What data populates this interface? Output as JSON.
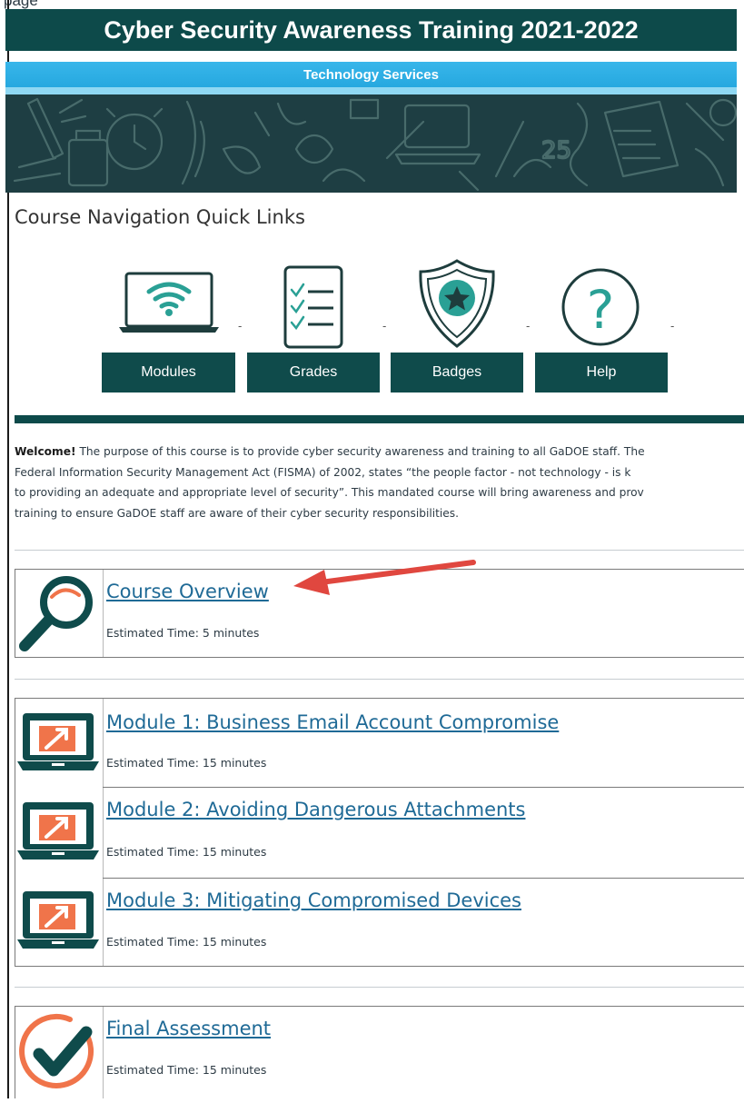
{
  "page_cut_text": "page",
  "header": {
    "title": "Cyber Security Awareness Training 2021-2022",
    "banner_label": "Technology Services"
  },
  "nav": {
    "heading": "Course Navigation Quick Links",
    "items": [
      {
        "label": "Modules",
        "icon": "laptop-wifi-icon"
      },
      {
        "label": "Grades",
        "icon": "checklist-icon"
      },
      {
        "label": "Badges",
        "icon": "shield-star-icon"
      },
      {
        "label": "Help",
        "icon": "question-circle-icon"
      }
    ],
    "separator": "-"
  },
  "welcome": {
    "bold": "Welcome!",
    "line1": " The purpose of this course is to provide cyber security awareness and training to all GaDOE staff. The",
    "line2": "Federal Information Security Management Act (FISMA) of 2002, states “the people factor - not technology - is k",
    "line3": "to providing an adequate and appropriate level of security”. This mandated course will bring awareness and prov",
    "line4": "training to ensure GaDOE staff are aware of their cyber security responsibilities."
  },
  "overview": {
    "title": "Course Overview",
    "time": "Estimated Time: 5 minutes",
    "icon": "magnifier-icon",
    "annotation": "red-arrow"
  },
  "modules": [
    {
      "title": "Module 1: Business Email Account Compromise",
      "time": "Estimated Time: 15 minutes",
      "icon": "laptop-arrow-icon"
    },
    {
      "title": "Module 2: Avoiding Dangerous Attachments",
      "time": "Estimated Time: 15 minutes",
      "icon": "laptop-arrow-icon"
    },
    {
      "title": "Module 3: Mitigating Compromised Devices",
      "time": "Estimated Time: 15 minutes",
      "icon": "laptop-arrow-icon"
    }
  ],
  "final": {
    "title": "Final Assessment",
    "time": "Estimated Time: 15 minutes",
    "icon": "checkmark-circle-icon"
  },
  "colors": {
    "teal": "#0d4a4a",
    "banner_blue": "#22a5dd",
    "link": "#1f6a96",
    "accent_orange": "#f0744a",
    "arrow_red": "#e0473f"
  }
}
